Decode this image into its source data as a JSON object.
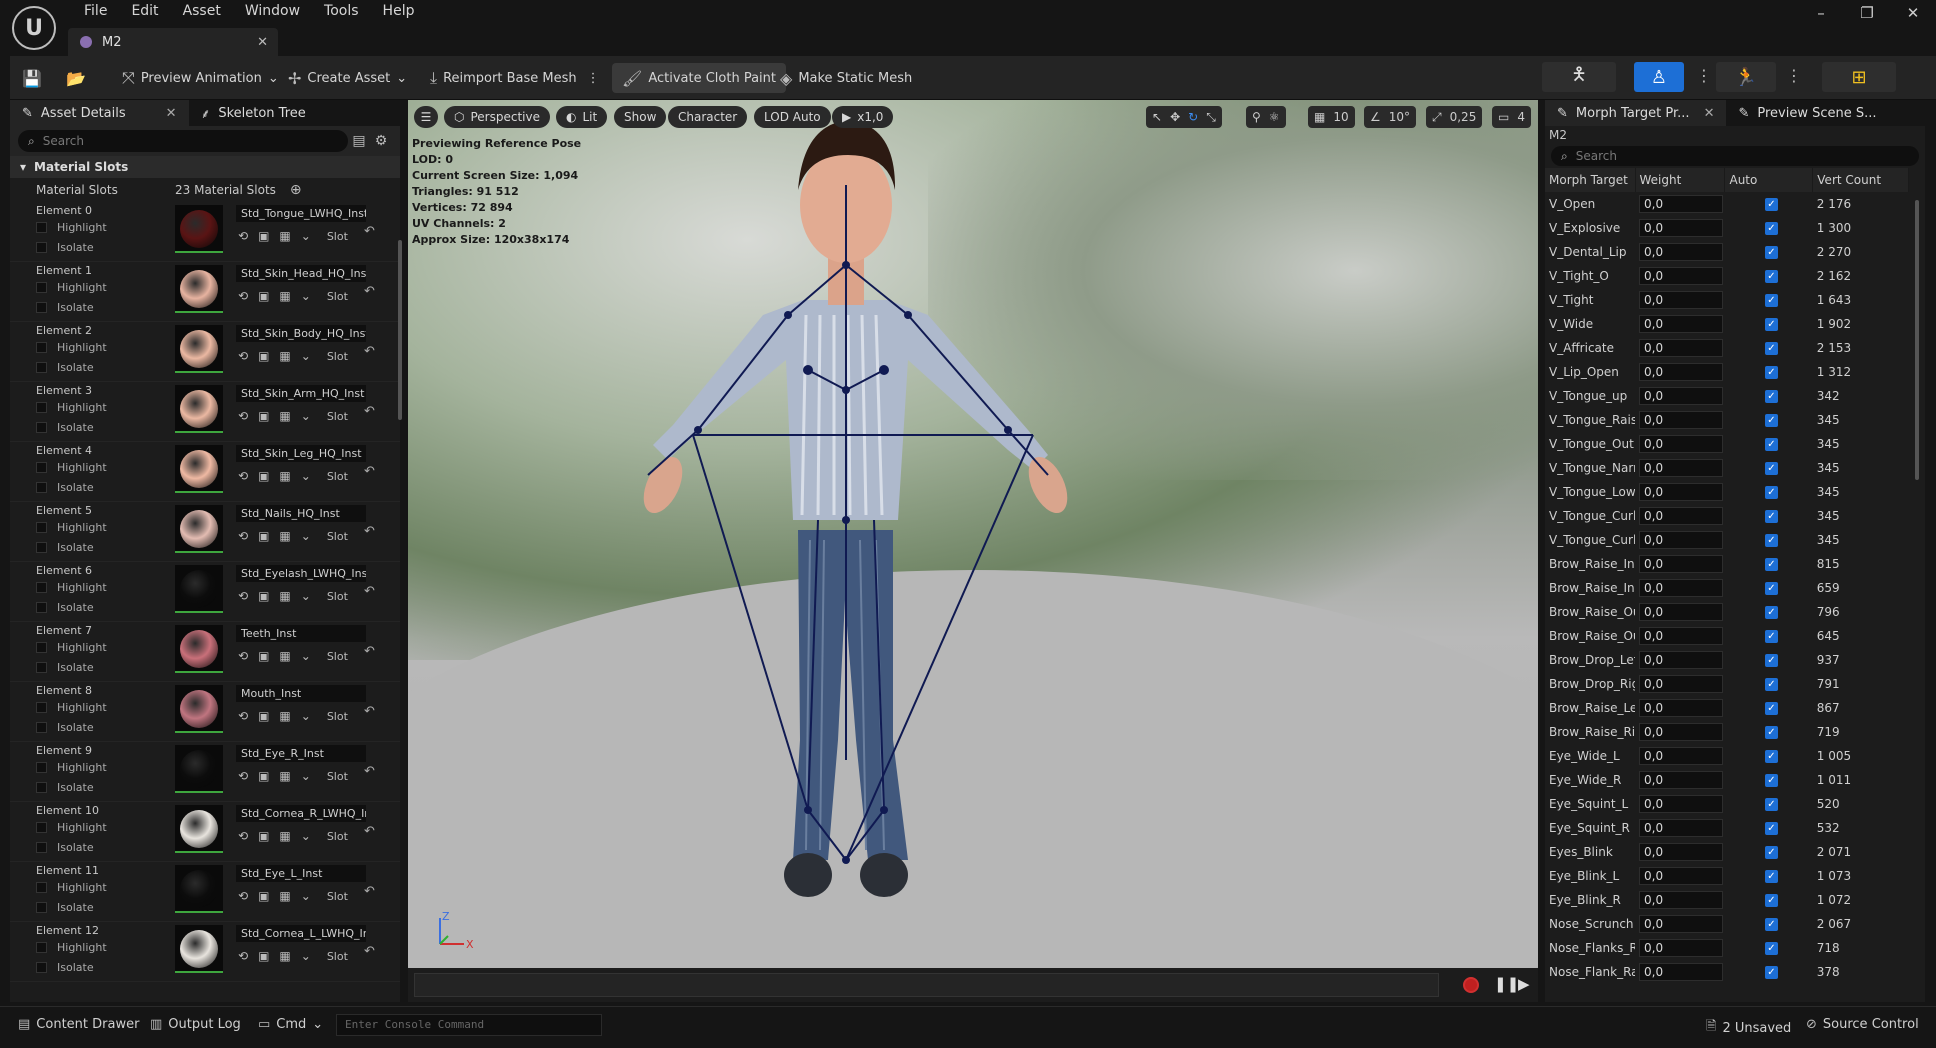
{
  "menu": [
    "File",
    "Edit",
    "Asset",
    "Window",
    "Tools",
    "Help"
  ],
  "document_tab": "M2",
  "toolbar": {
    "preview_animation": "Preview Animation",
    "create_asset": "Create Asset",
    "reimport": "Reimport Base Mesh",
    "activate_cloth_paint": "Activate Cloth Paint",
    "make_static_mesh": "Make Static Mesh"
  },
  "left_panel": {
    "tab_asset_details": "Asset Details",
    "tab_skeleton_tree": "Skeleton Tree",
    "search_placeholder": "Search",
    "section": "Material Slots",
    "slots_label": "Material Slots",
    "slots_count": "23 Material Slots",
    "highlight": "Highlight",
    "isolate": "Isolate",
    "slot": "Slot",
    "elements": [
      {
        "name": "Element 0",
        "material": "Std_Tongue_LWHQ_Inst",
        "color": "#5a1414"
      },
      {
        "name": "Element 1",
        "material": "Std_Skin_Head_HQ_Inst",
        "color": "#e7b3a0"
      },
      {
        "name": "Element 2",
        "material": "Std_Skin_Body_HQ_Inst",
        "color": "#ebb8a2"
      },
      {
        "name": "Element 3",
        "material": "Std_Skin_Arm_HQ_Inst",
        "color": "#ebb8a2"
      },
      {
        "name": "Element 4",
        "material": "Std_Skin_Leg_HQ_Inst",
        "color": "#efb9a3"
      },
      {
        "name": "Element 5",
        "material": "Std_Nails_HQ_Inst",
        "color": "#e3bcb2"
      },
      {
        "name": "Element 6",
        "material": "Std_Eyelash_LWHQ_Inst",
        "color": "#0c0c0c"
      },
      {
        "name": "Element 7",
        "material": "Teeth_Inst",
        "color": "#c9707a"
      },
      {
        "name": "Element 8",
        "material": "Mouth_Inst",
        "color": "#c07580"
      },
      {
        "name": "Element 9",
        "material": "Std_Eye_R_Inst",
        "color": "#0c0c0c"
      },
      {
        "name": "Element 10",
        "material": "Std_Cornea_R_LWHQ_Inst",
        "color": "#e8e4de"
      },
      {
        "name": "Element 11",
        "material": "Std_Eye_L_Inst",
        "color": "#0c0c0c"
      },
      {
        "name": "Element 12",
        "material": "Std_Cornea_L_LWHQ_Inst",
        "color": "#e8e4de"
      }
    ]
  },
  "viewport": {
    "perspective": "Perspective",
    "lit": "Lit",
    "show": "Show",
    "character": "Character",
    "lod": "LOD Auto",
    "speed": "x1,0",
    "grid": "10",
    "angle": "10°",
    "scale": "0,25",
    "cam": "4",
    "info": [
      "Previewing Reference Pose",
      "LOD: 0",
      "Current Screen Size: 1,094",
      "Triangles: 91 512",
      "Vertices: 72 894",
      "UV Channels: 2",
      "Approx Size: 120x38x174"
    ],
    "axis_z": "Z",
    "axis_x": "X"
  },
  "right_panel": {
    "tab_morph": "Morph Target Pr...",
    "tab_scene": "Preview Scene S...",
    "asset": "M2",
    "search_placeholder": "Search",
    "headers": [
      "Morph Target",
      "Weight",
      "Auto",
      "Vert Count"
    ],
    "rows": [
      [
        "V_Open",
        "0,0",
        "2 176"
      ],
      [
        "V_Explosive",
        "0,0",
        "1 300"
      ],
      [
        "V_Dental_Lip",
        "0,0",
        "2 270"
      ],
      [
        "V_Tight_O",
        "0,0",
        "2 162"
      ],
      [
        "V_Tight",
        "0,0",
        "1 643"
      ],
      [
        "V_Wide",
        "0,0",
        "1 902"
      ],
      [
        "V_Affricate",
        "0,0",
        "2 153"
      ],
      [
        "V_Lip_Open",
        "0,0",
        "1 312"
      ],
      [
        "V_Tongue_up",
        "0,0",
        "342"
      ],
      [
        "V_Tongue_Rais",
        "0,0",
        "345"
      ],
      [
        "V_Tongue_Out",
        "0,0",
        "345"
      ],
      [
        "V_Tongue_Narr",
        "0,0",
        "345"
      ],
      [
        "V_Tongue_Low",
        "0,0",
        "345"
      ],
      [
        "V_Tongue_Curl",
        "0,0",
        "345"
      ],
      [
        "V_Tongue_Curl",
        "0,0",
        "345"
      ],
      [
        "Brow_Raise_Inr",
        "0,0",
        "815"
      ],
      [
        "Brow_Raise_Inr",
        "0,0",
        "659"
      ],
      [
        "Brow_Raise_Ou",
        "0,0",
        "796"
      ],
      [
        "Brow_Raise_Ou",
        "0,0",
        "645"
      ],
      [
        "Brow_Drop_Lef",
        "0,0",
        "937"
      ],
      [
        "Brow_Drop_Rig",
        "0,0",
        "791"
      ],
      [
        "Brow_Raise_Le",
        "0,0",
        "867"
      ],
      [
        "Brow_Raise_Rig",
        "0,0",
        "719"
      ],
      [
        "Eye_Wide_L",
        "0,0",
        "1 005"
      ],
      [
        "Eye_Wide_R",
        "0,0",
        "1 011"
      ],
      [
        "Eye_Squint_L",
        "0,0",
        "520"
      ],
      [
        "Eye_Squint_R",
        "0,0",
        "532"
      ],
      [
        "Eyes_Blink",
        "0,0",
        "2 071"
      ],
      [
        "Eye_Blink_L",
        "0,0",
        "1 073"
      ],
      [
        "Eye_Blink_R",
        "0,0",
        "1 072"
      ],
      [
        "Nose_Scrunch",
        "0,0",
        "2 067"
      ],
      [
        "Nose_Flanks_R",
        "0,0",
        "718"
      ],
      [
        "Nose_Flank_Ra",
        "0,0",
        "378"
      ]
    ]
  },
  "status": {
    "content_drawer": "Content Drawer",
    "output_log": "Output Log",
    "cmd": "Cmd",
    "console_placeholder": "Enter Console Command",
    "unsaved": "2 Unsaved",
    "source_control": "Source Control"
  }
}
